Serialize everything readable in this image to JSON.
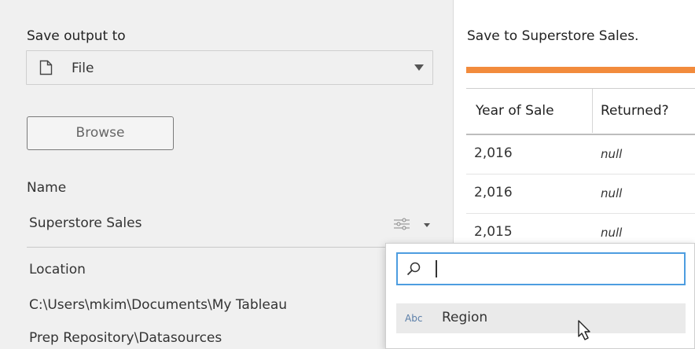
{
  "output": {
    "save_output_label": "Save output to",
    "output_type": {
      "value": "File",
      "icon": "file-icon"
    },
    "browse_label": "Browse",
    "name_label": "Name",
    "name_value": "Superstore Sales",
    "location_label": "Location",
    "location_line1": "C:\\Users\\mkim\\Documents\\My Tableau",
    "location_line2": "Prep Repository\\Datasources"
  },
  "preview": {
    "title": "Save to Superstore Sales.",
    "accent_color": "#f28b3c",
    "columns": [
      "Year of Sale",
      "Returned?"
    ],
    "rows": [
      [
        "2,016",
        "null"
      ],
      [
        "2,016",
        "null"
      ],
      [
        "2,015",
        "null"
      ]
    ]
  },
  "field_search": {
    "query": "",
    "suggestion_type": "Abc",
    "suggestion_label": "Region"
  }
}
